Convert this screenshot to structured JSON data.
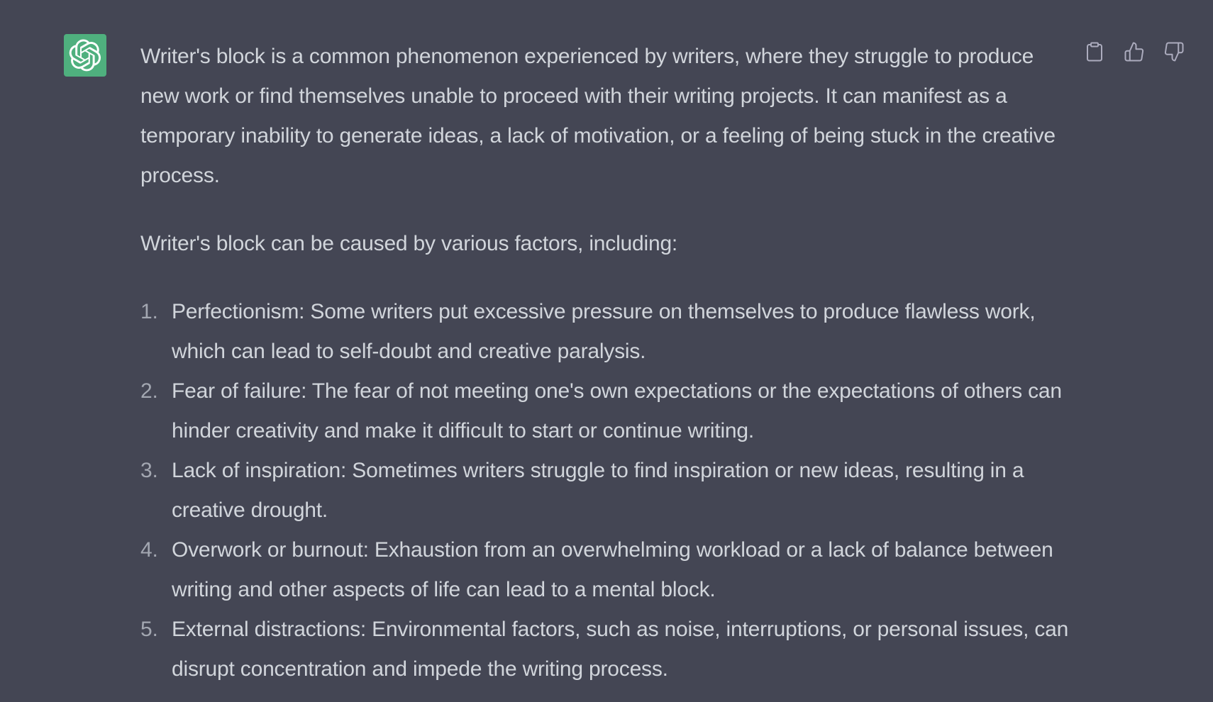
{
  "message": {
    "role": "assistant",
    "avatar_icon": "openai-logo-icon",
    "avatar_color": "#4fb07e",
    "paragraphs": [
      "Writer's block is a common phenomenon experienced by writers, where they struggle to produce new work or find themselves unable to proceed with their writing projects. It can manifest as a temporary inability to generate ideas, a lack of motivation, or a feeling of being stuck in the creative process.",
      "Writer's block can be caused by various factors, including:"
    ],
    "list": [
      {
        "num": "1.",
        "text": "Perfectionism: Some writers put excessive pressure on themselves to produce flawless work, which can lead to self-doubt and creative paralysis."
      },
      {
        "num": "2.",
        "text": "Fear of failure: The fear of not meeting one's own expectations or the expectations of others can hinder creativity and make it difficult to start or continue writing."
      },
      {
        "num": "3.",
        "text": "Lack of inspiration: Sometimes writers struggle to find inspiration or new ideas, resulting in a creative drought."
      },
      {
        "num": "4.",
        "text": "Overwork or burnout: Exhaustion from an overwhelming workload or a lack of balance between writing and other aspects of life can lead to a mental block."
      },
      {
        "num": "5.",
        "text": "External distractions: Environmental factors, such as noise, interruptions, or personal issues, can disrupt concentration and impede the writing process."
      }
    ]
  },
  "actions": {
    "copy_icon": "clipboard-icon",
    "like_icon": "thumbs-up-icon",
    "dislike_icon": "thumbs-down-icon"
  },
  "colors": {
    "background": "#444654",
    "text": "#d1d5db",
    "icon": "#acacbe"
  }
}
